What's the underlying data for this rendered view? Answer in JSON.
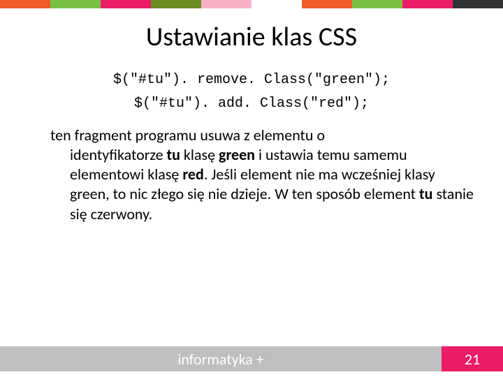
{
  "title": "Ustawianie klas CSS",
  "code": {
    "line1": "$(\"#tu\"). remove. Class(\"green\");",
    "line2": "$(\"#tu\"). add. Class(\"red\");"
  },
  "body": {
    "line1": "ten fragment programu usuwa z elementu o",
    "seg1": "identyfikatorze ",
    "b1": "tu",
    "seg2": " klasę ",
    "b2": "green",
    "seg3": " i ustawia temu samemu elementowi klasę ",
    "b3": "red",
    "seg4": ". Jeśli element nie ma wcześniej klasy green, to nic złego się nie dzieje. W ten sposób element ",
    "b4": "tu",
    "seg5": " stanie się czerwony."
  },
  "footer": {
    "label": "informatyka +",
    "page": "21"
  }
}
